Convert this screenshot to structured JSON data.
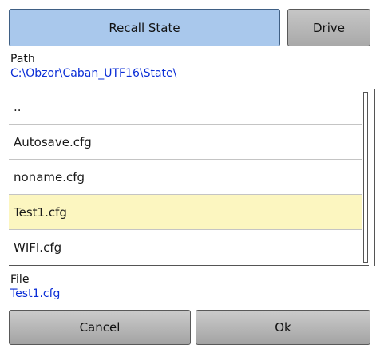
{
  "header": {
    "title": "Recall State",
    "drive_label": "Drive"
  },
  "path": {
    "caption": "Path",
    "value": "C:\\Obzor\\Caban_UTF16\\State\\"
  },
  "files": [
    {
      "name": ".."
    },
    {
      "name": "Autosave.cfg"
    },
    {
      "name": "noname.cfg"
    },
    {
      "name": "Test1.cfg",
      "selected": true
    },
    {
      "name": "WIFI.cfg"
    }
  ],
  "file": {
    "caption": "File",
    "value": "Test1.cfg"
  },
  "footer": {
    "cancel_label": "Cancel",
    "ok_label": "Ok"
  },
  "colors": {
    "title_bg": "#a9c8ec",
    "selected_row": "#fcf6c0",
    "path_text": "#0a2dd6"
  }
}
